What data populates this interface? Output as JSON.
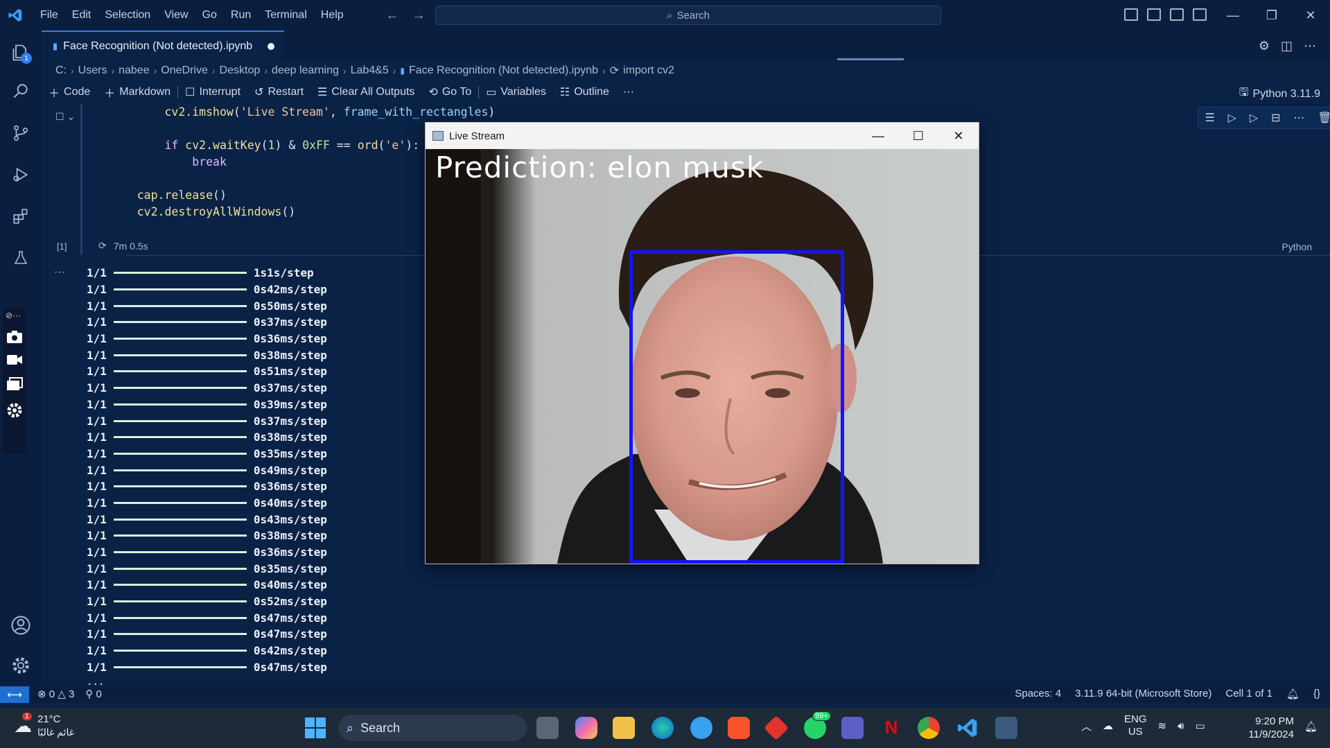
{
  "menu": [
    "File",
    "Edit",
    "Selection",
    "View",
    "Go",
    "Run",
    "Terminal",
    "Help"
  ],
  "search": {
    "placeholder": "Search"
  },
  "tab": {
    "title": "Face Recognition (Not detected).ipynb"
  },
  "explorer_badge": "1",
  "breadcrumb": [
    "C:",
    "Users",
    "nabee",
    "OneDrive",
    "Desktop",
    "deep learning",
    "Lab4&5",
    "Face Recognition (Not detected).ipynb",
    "import cv2"
  ],
  "toolbar": {
    "code": "Code",
    "markdown": "Markdown",
    "interrupt": "Interrupt",
    "restart": "Restart",
    "clear_outputs": "Clear All Outputs",
    "goto": "Go To",
    "variables": "Variables",
    "outline": "Outline",
    "more": "···",
    "kernel": "Python 3.11.9"
  },
  "code_lines": {
    "l1_fn": "cv2.imshow",
    "l1_s": "'Live Stream'",
    "l1_v": "frame_with_rectangles",
    "l2_kw": "if",
    "l2_fn": "cv2.waitKey",
    "l2_n1": "1",
    "l2_n2": "0xFF",
    "l2_fn2": "ord",
    "l2_s": "'e'",
    "l3_kw": "break",
    "l4_fn": "cap.release",
    "l5_fn": "cv2.destroyAllWindows"
  },
  "cell": {
    "exec_count": "[1]",
    "exec_time": "7m 0.5s",
    "language": "Python"
  },
  "output": [
    {
      "step": "1/1",
      "time": "1s",
      "rate": "1s/step"
    },
    {
      "step": "1/1",
      "time": "0s",
      "rate": "42ms/step"
    },
    {
      "step": "1/1",
      "time": "0s",
      "rate": "50ms/step"
    },
    {
      "step": "1/1",
      "time": "0s",
      "rate": "37ms/step"
    },
    {
      "step": "1/1",
      "time": "0s",
      "rate": "36ms/step"
    },
    {
      "step": "1/1",
      "time": "0s",
      "rate": "38ms/step"
    },
    {
      "step": "1/1",
      "time": "0s",
      "rate": "51ms/step"
    },
    {
      "step": "1/1",
      "time": "0s",
      "rate": "37ms/step"
    },
    {
      "step": "1/1",
      "time": "0s",
      "rate": "39ms/step"
    },
    {
      "step": "1/1",
      "time": "0s",
      "rate": "37ms/step"
    },
    {
      "step": "1/1",
      "time": "0s",
      "rate": "38ms/step"
    },
    {
      "step": "1/1",
      "time": "0s",
      "rate": "35ms/step"
    },
    {
      "step": "1/1",
      "time": "0s",
      "rate": "49ms/step"
    },
    {
      "step": "1/1",
      "time": "0s",
      "rate": "36ms/step"
    },
    {
      "step": "1/1",
      "time": "0s",
      "rate": "40ms/step"
    },
    {
      "step": "1/1",
      "time": "0s",
      "rate": "43ms/step"
    },
    {
      "step": "1/1",
      "time": "0s",
      "rate": "38ms/step"
    },
    {
      "step": "1/1",
      "time": "0s",
      "rate": "36ms/step"
    },
    {
      "step": "1/1",
      "time": "0s",
      "rate": "35ms/step"
    },
    {
      "step": "1/1",
      "time": "0s",
      "rate": "40ms/step"
    },
    {
      "step": "1/1",
      "time": "0s",
      "rate": "52ms/step"
    },
    {
      "step": "1/1",
      "time": "0s",
      "rate": "47ms/step"
    },
    {
      "step": "1/1",
      "time": "0s",
      "rate": "47ms/step"
    },
    {
      "step": "1/1",
      "time": "0s",
      "rate": "42ms/step"
    },
    {
      "step": "1/1",
      "time": "0s",
      "rate": "47ms/step"
    }
  ],
  "output_more": "...",
  "live_window": {
    "title": "Live Stream",
    "prediction": "Prediction: elon musk"
  },
  "status": {
    "errors": "0",
    "warnings": "3",
    "ports": "0",
    "spaces": "Spaces: 4",
    "interpreter": "3.11.9 64-bit (Microsoft Store)",
    "cell": "Cell 1 of 1"
  },
  "taskbar": {
    "weather_temp": "21°C",
    "weather_desc": "غائم غالبًا",
    "weather_badge": "1",
    "search": "Search",
    "whatsapp_badge": "99+",
    "lang1": "ENG",
    "lang2": "US",
    "time": "9:20 PM",
    "date": "11/9/2024"
  },
  "colors": {
    "editor_bg": "#0b2247",
    "face_box": "#1414ff",
    "accent": "#1d6fd1"
  }
}
